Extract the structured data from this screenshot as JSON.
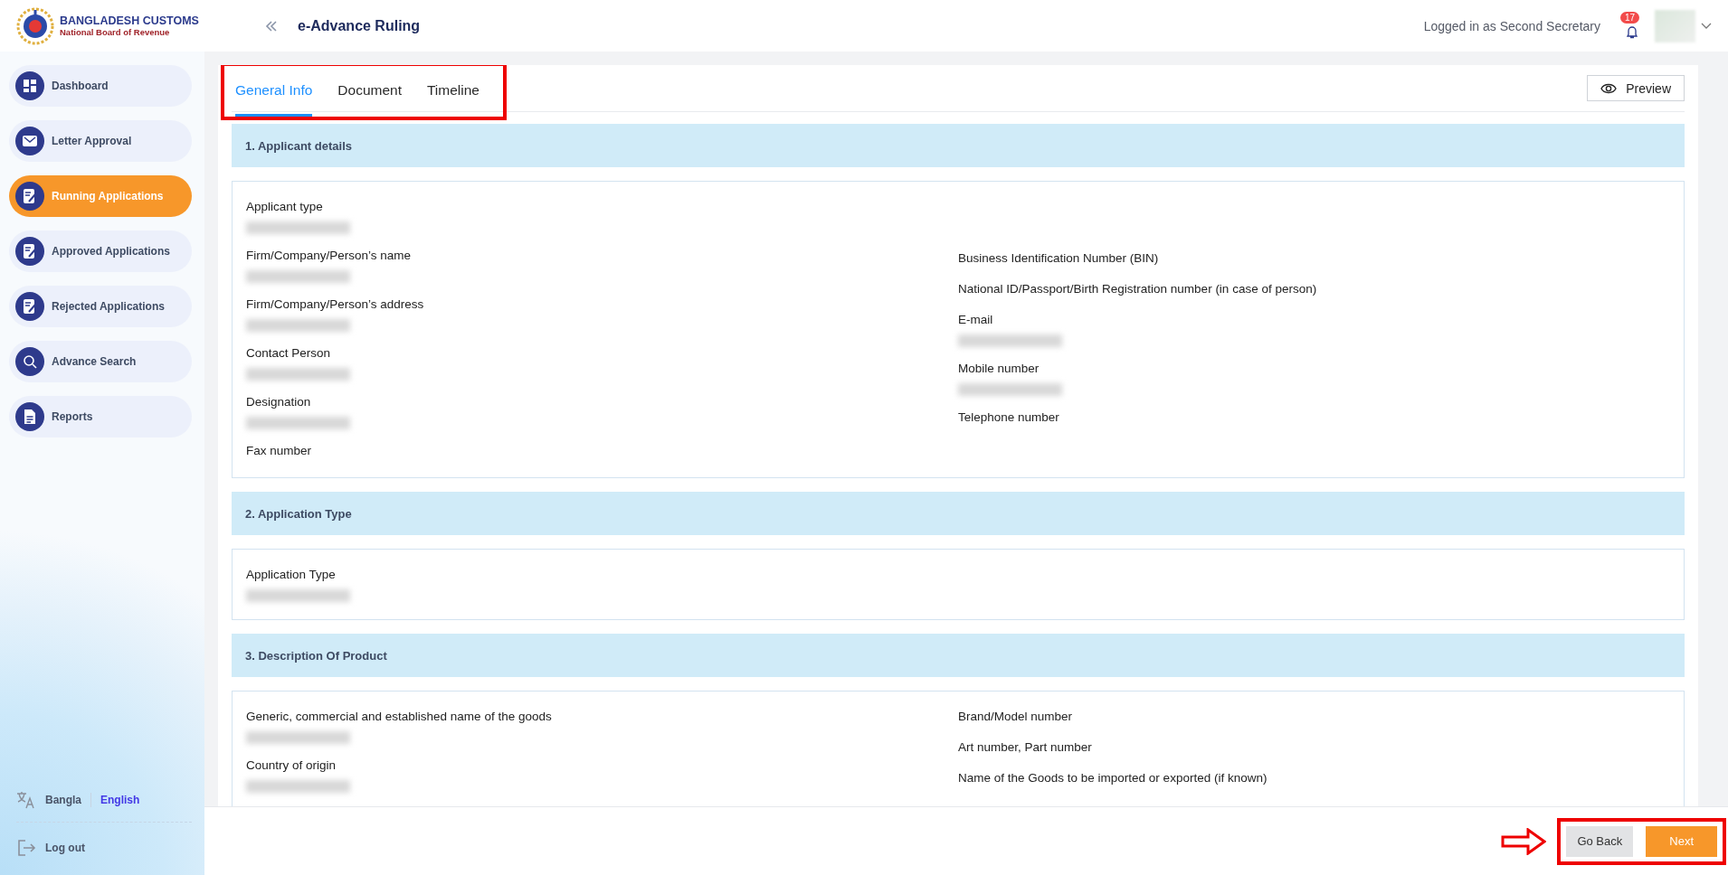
{
  "header": {
    "logo": {
      "title": "BANGLADESH CUSTOMS",
      "subtitle": "National Board of Revenue"
    },
    "page_title": "e-Advance Ruling",
    "user_status": "Logged in as Second Secretary",
    "notification_count": "17"
  },
  "sidebar": {
    "items": [
      {
        "label": "Dashboard",
        "kind": "grid",
        "selected": false
      },
      {
        "label": "Letter Approval",
        "kind": "mail",
        "selected": false
      },
      {
        "label": "Running Applications",
        "kind": "document",
        "selected": true
      },
      {
        "label": "Approved Applications",
        "kind": "document",
        "selected": false
      },
      {
        "label": "Rejected Applications",
        "kind": "document",
        "selected": false
      },
      {
        "label": "Advance Search",
        "kind": "search",
        "selected": false
      },
      {
        "label": "Reports",
        "kind": "report",
        "selected": false
      }
    ],
    "languages": [
      {
        "label": "Bangla",
        "selected": false
      },
      {
        "label": "English",
        "selected": true
      }
    ],
    "logout": "Log out"
  },
  "tabs": [
    {
      "label": "General Info",
      "selected": true
    },
    {
      "label": "Document",
      "selected": false
    },
    {
      "label": "Timeline",
      "selected": false
    }
  ],
  "preview_button": "Preview",
  "sections": [
    {
      "title": "1. Applicant details",
      "columns": [
        [
          {
            "label": "Applicant type",
            "value_blurred": true
          },
          {
            "label": "Firm/Company/Person’s name",
            "value_blurred": true
          },
          {
            "label": "Firm/Company/Person’s address",
            "value_blurred": true
          },
          {
            "label": "Contact Person",
            "value_blurred": true
          },
          {
            "label": "Designation",
            "value_blurred": true
          },
          {
            "label": "Fax number",
            "value_blurred": false
          }
        ],
        [
          {
            "label": "Business Identification Number (BIN)",
            "value_blurred": false
          },
          {
            "label": "National ID/Passport/Birth Registration number (in case of person)",
            "value_blurred": false
          },
          {
            "label": "E-mail",
            "value_blurred": true
          },
          {
            "label": "Mobile number",
            "value_blurred": true
          },
          {
            "label": "Telephone number",
            "value_blurred": false
          }
        ]
      ]
    },
    {
      "title": "2. Application Type",
      "columns": [
        [
          {
            "label": "Application Type",
            "value_blurred": true
          }
        ]
      ]
    },
    {
      "title": "3. Description Of Product",
      "columns": [
        [
          {
            "label": "Generic, commercial and established name of the goods",
            "value_blurred": true
          },
          {
            "label": "Country of origin",
            "value_blurred": true
          }
        ],
        [
          {
            "label": "Brand/Model number",
            "value_blurred": false
          },
          {
            "label": "Art number, Part number",
            "value_blurred": false
          },
          {
            "label": "Name of the Goods to be imported or exported (if known)",
            "value_blurred": false
          }
        ]
      ]
    }
  ],
  "footer": {
    "buttons": [
      {
        "label": "Go Back",
        "kind": "secondary"
      },
      {
        "label": "Next",
        "kind": "primary"
      }
    ]
  },
  "annotations": {
    "tabs_highlighted": true,
    "buttons_highlighted": true
  }
}
